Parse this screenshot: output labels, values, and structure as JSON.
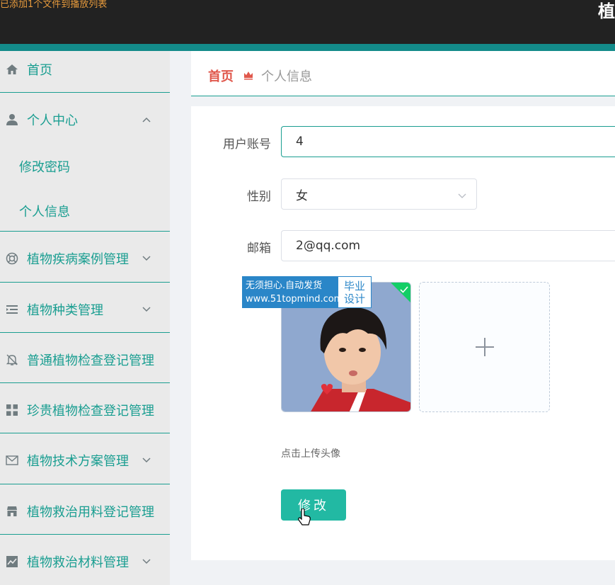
{
  "topbar": {
    "notice": "已添加1个文件到播放列表",
    "title_fragment": "植"
  },
  "colors": {
    "accent": "#1a9e91",
    "topbar_bg": "#222222",
    "topbar_stripe": "#138b8a",
    "sidebar_bg": "#eaeaea",
    "breadcrumb_home": "#e0574b",
    "button_bg": "#22b9a3"
  },
  "sidebar": {
    "items": [
      {
        "label": "首页",
        "icon": "home-icon"
      },
      {
        "label": "个人中心",
        "icon": "user-icon",
        "expanded": true
      },
      {
        "label": "植物疾病案例管理",
        "icon": "lifebuoy-icon"
      },
      {
        "label": "植物种类管理",
        "icon": "list-icon"
      },
      {
        "label": "普通植物检查登记管理",
        "icon": "bell-off-icon"
      },
      {
        "label": "珍贵植物检查登记管理",
        "icon": "grid-icon"
      },
      {
        "label": "植物技术方案管理",
        "icon": "mail-icon"
      },
      {
        "label": "植物救治用料登记管理",
        "icon": "shop-icon"
      },
      {
        "label": "植物救治材料管理",
        "icon": "chart-icon"
      }
    ],
    "sub_items": [
      {
        "label": "修改密码"
      },
      {
        "label": "个人信息",
        "active": true
      }
    ]
  },
  "breadcrumb": {
    "home": "首页",
    "current": "个人信息"
  },
  "form": {
    "account_label": "用户账号",
    "account_value": "4",
    "gender_label": "性别",
    "gender_value": "女",
    "email_label": "邮箱",
    "email_value": "2@qq.com",
    "upload_hint": "点击上传头像",
    "submit_label": "修改"
  },
  "watermark": {
    "line1": "无须担心.自动发货",
    "line2": "www.51topmind.com",
    "badge1": "毕业",
    "badge2": "设计"
  }
}
